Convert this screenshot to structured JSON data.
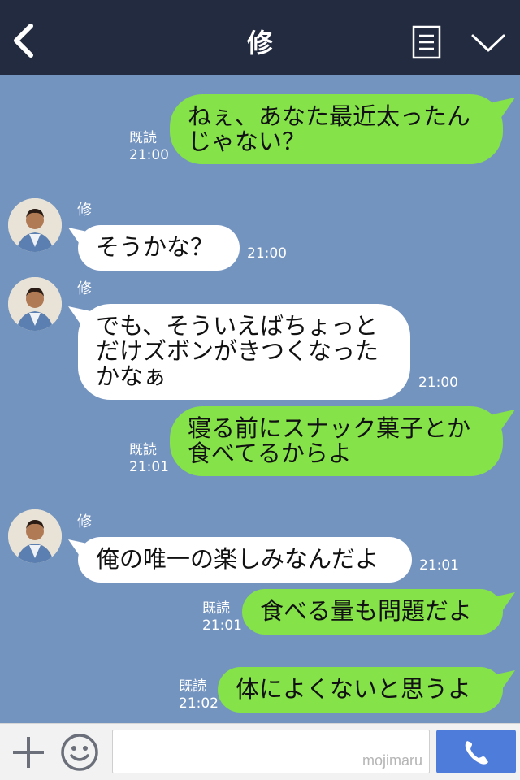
{
  "header": {
    "title": "修"
  },
  "messages": [
    {
      "side": "me",
      "text": "ねぇ、あなた最近太ったん\nじゃない？",
      "read": "既読",
      "time": "21:00"
    },
    {
      "side": "them",
      "sender": "修",
      "text": "そうかな？",
      "time": "21:00"
    },
    {
      "side": "them",
      "sender": "修",
      "text": "でも、そういえばちょっと\nだけズボンがきつくなった\nかなぁ",
      "time": "21:00"
    },
    {
      "side": "me",
      "text": "寝る前にスナック菓子とか\n食べてるからよ",
      "read": "既読",
      "time": "21:01"
    },
    {
      "side": "them",
      "sender": "修",
      "text": "俺の唯一の楽しみなんだよ",
      "time": "21:01"
    },
    {
      "side": "me",
      "text": "食べる量も問題だよ",
      "read": "既読",
      "time": "21:01"
    },
    {
      "side": "me",
      "text": "体によくないと思うよ",
      "read": "既読",
      "time": "21:02"
    }
  ],
  "footer": {
    "watermark": "mojimaru"
  },
  "colors": {
    "header_bg": "#232b40",
    "chat_bg": "#7494c0",
    "my_bubble": "#85e249",
    "their_bubble": "#ffffff",
    "call_button": "#4d7cdb"
  },
  "icons": [
    "back-arrow-icon",
    "menu-list-icon",
    "chevron-down-icon",
    "plus-icon",
    "smiley-icon",
    "phone-icon"
  ]
}
